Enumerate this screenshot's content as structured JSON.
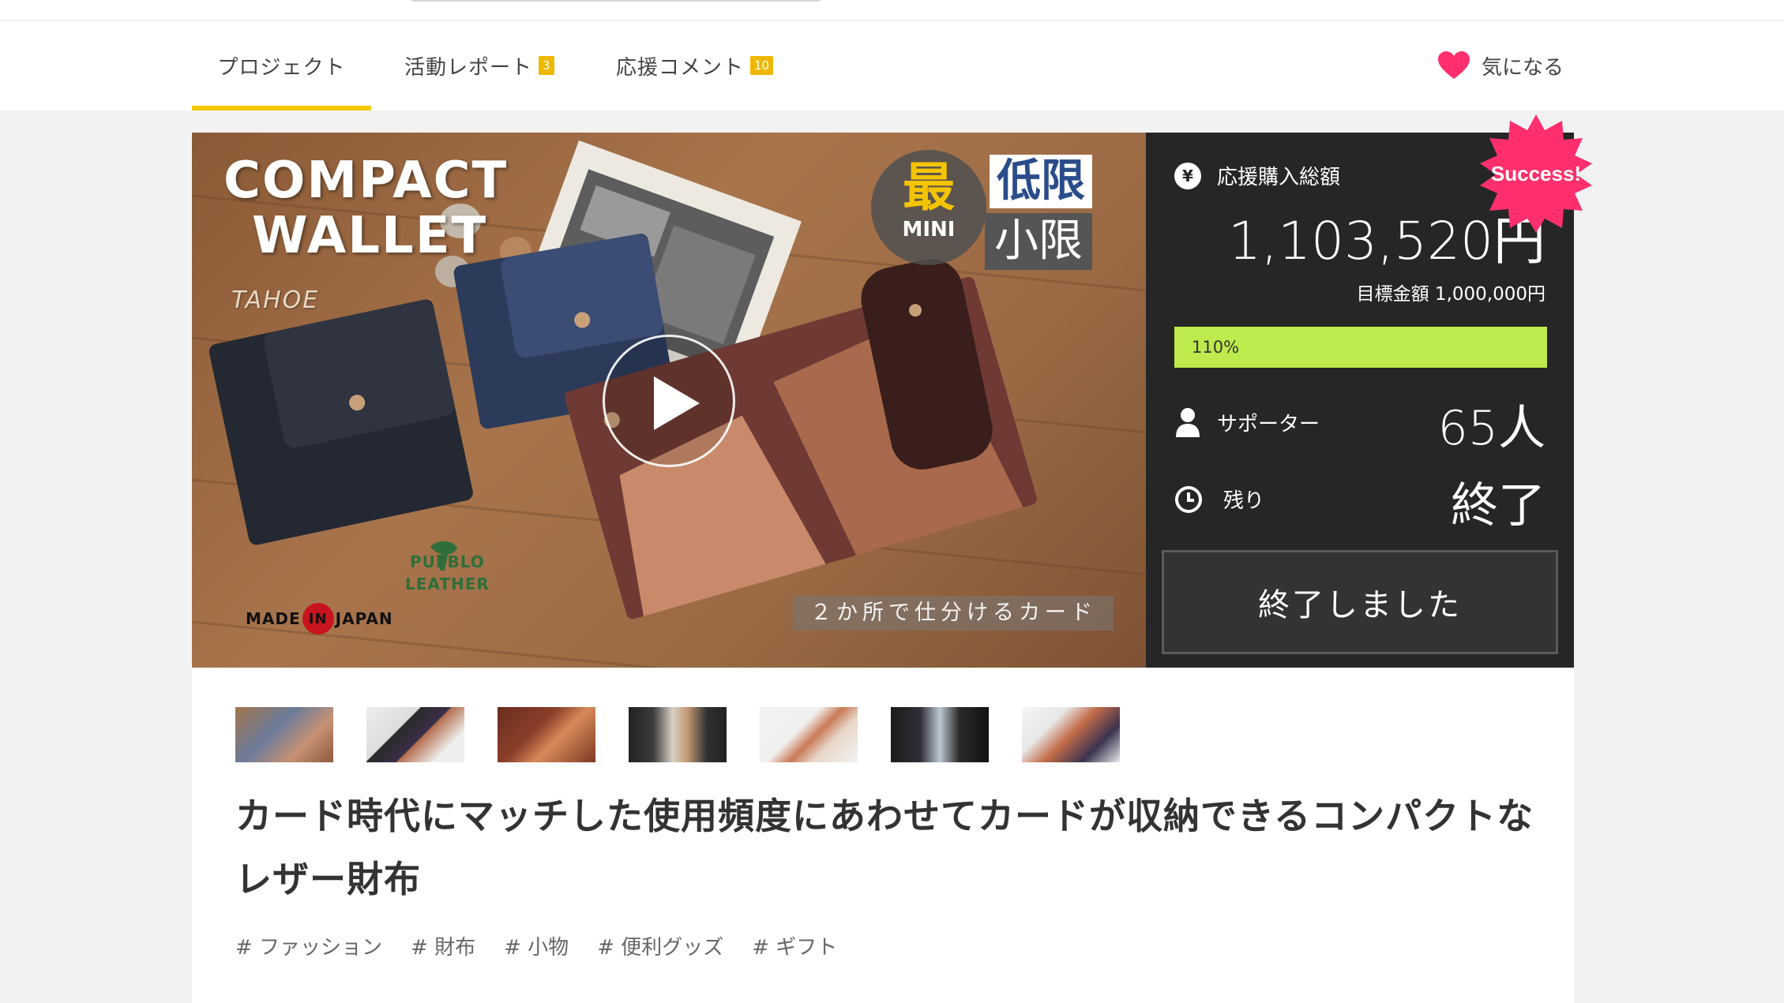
{
  "nav": {
    "tabs": [
      {
        "label": "プロジェクト",
        "badge": ""
      },
      {
        "label": "活動レポート",
        "badge": "3"
      },
      {
        "label": "応援コメント",
        "badge": "10"
      }
    ],
    "favorite_label": "気になる"
  },
  "hero": {
    "title_line1": "COMPACT",
    "title_line2": "WALLET",
    "brand": "TAHOE",
    "made_in_left": "MADE",
    "made_in_mid": "IN",
    "made_in_right": "JAPAN",
    "pueblo_line1": "PUEBLO",
    "pueblo_line2": "LEATHER",
    "caption": "２か所で仕分けるカード",
    "mini_kanji": "最",
    "mini_text": "MINI",
    "minimum_kanji1": "低限",
    "minimum_kanji2": "小限"
  },
  "stats": {
    "total_label": "応援購入総額",
    "total_amount": "1,103,520円",
    "goal_text": "目標金額 1,000,000円",
    "progress_text": "110%",
    "progress_fraction": 1.0,
    "supporters_label": "サポーター",
    "supporters_value": "65人",
    "remaining_label": "残り",
    "remaining_value": "終了",
    "end_button_label": "終了しました",
    "success_badge": "Success!"
  },
  "project": {
    "title": "カード時代にマッチした使用頻度にあわせてカードが収納できるコンパクトなレザー財布",
    "tags": [
      "# ファッション",
      "# 財布",
      "# 小物",
      "# 便利グッズ",
      "# ギフト"
    ]
  },
  "colors": {
    "accent_yellow": "#f5c700",
    "badge_orange": "#efb800",
    "progress_green": "#bdea4c",
    "success_pink": "#ff2f6d",
    "heart_pink": "#ff2f6d",
    "panel_dark": "#262626"
  }
}
